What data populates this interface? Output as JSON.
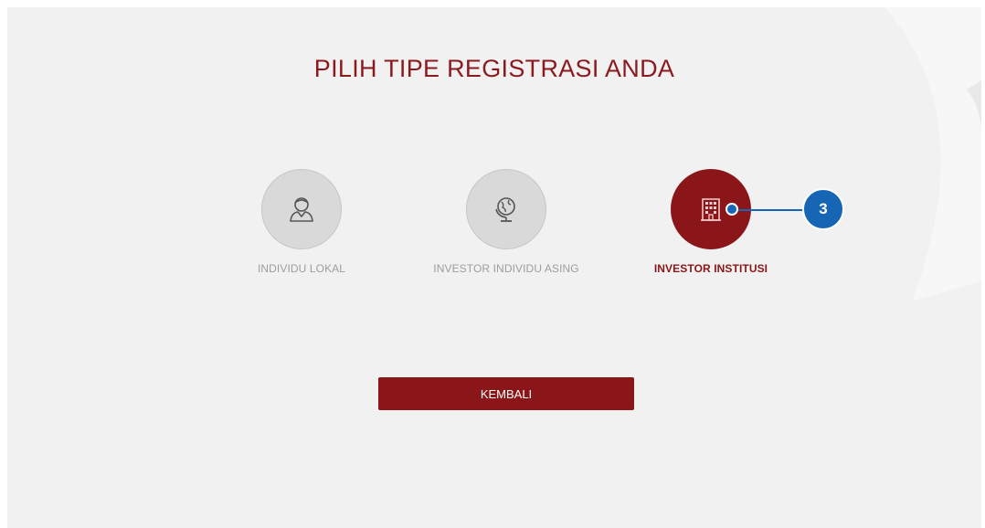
{
  "page": {
    "title": "PILIH TIPE REGISTRASI ANDA"
  },
  "options": [
    {
      "label": "INDIVIDU LOKAL",
      "icon": "person-icon",
      "state": "inactive"
    },
    {
      "label": "INVESTOR INDIVIDU ASING",
      "icon": "globe-icon",
      "state": "inactive"
    },
    {
      "label": "INVESTOR INSTITUSI",
      "icon": "building-icon",
      "state": "active"
    }
  ],
  "back_button": {
    "label": "KEMBALI"
  },
  "callout": {
    "number": "3"
  },
  "colors": {
    "accent": "#8b1619",
    "background": "#f1f1f1",
    "inactive_circle": "#d9d9d9",
    "inactive_text": "#9d9d9d",
    "callout": "#1666b5"
  }
}
